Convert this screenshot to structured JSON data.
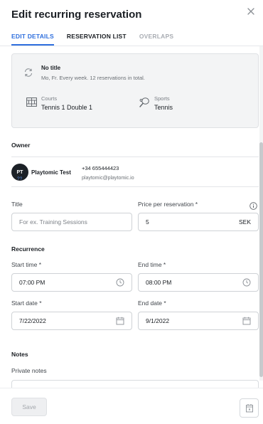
{
  "header": {
    "title": "Edit recurring reservation"
  },
  "tabs": [
    {
      "label": "EDIT DETAILS"
    },
    {
      "label": "RESERVATION LIST"
    },
    {
      "label": "OVERLAPS"
    }
  ],
  "summary": {
    "title": "No title",
    "description": "Mo, Fr. Every week. 12 reservations in total.",
    "courts_label": "Courts",
    "courts_value": "Tennis 1 Double 1",
    "sports_label": "Sports",
    "sports_value": "Tennis"
  },
  "owner": {
    "section_title": "Owner",
    "initials": "PT",
    "level": "??",
    "name": "Playtomic Test",
    "phone": "+34 655444423",
    "email": "playtomic@playtomic.io"
  },
  "form": {
    "title_label": "Title",
    "title_placeholder": "For ex. Training Sessions",
    "price_label": "Price per reservation *",
    "price_value": "5",
    "price_currency": "SEK",
    "recurrence_title": "Recurrence",
    "start_time_label": "Start time *",
    "start_time_value": "07:00 PM",
    "end_time_label": "End time *",
    "end_time_value": "08:00 PM",
    "start_date_label": "Start date *",
    "start_date_value": "7/22/2022",
    "end_date_label": "End date *",
    "end_date_value": "9/1/2022",
    "notes_title": "Notes",
    "private_notes_label": "Private notes"
  },
  "footer": {
    "save_label": "Save"
  },
  "colors": {
    "accent": "#2f6fde",
    "muted": "#a9adb3",
    "avatar_bg": "#1c2127"
  }
}
